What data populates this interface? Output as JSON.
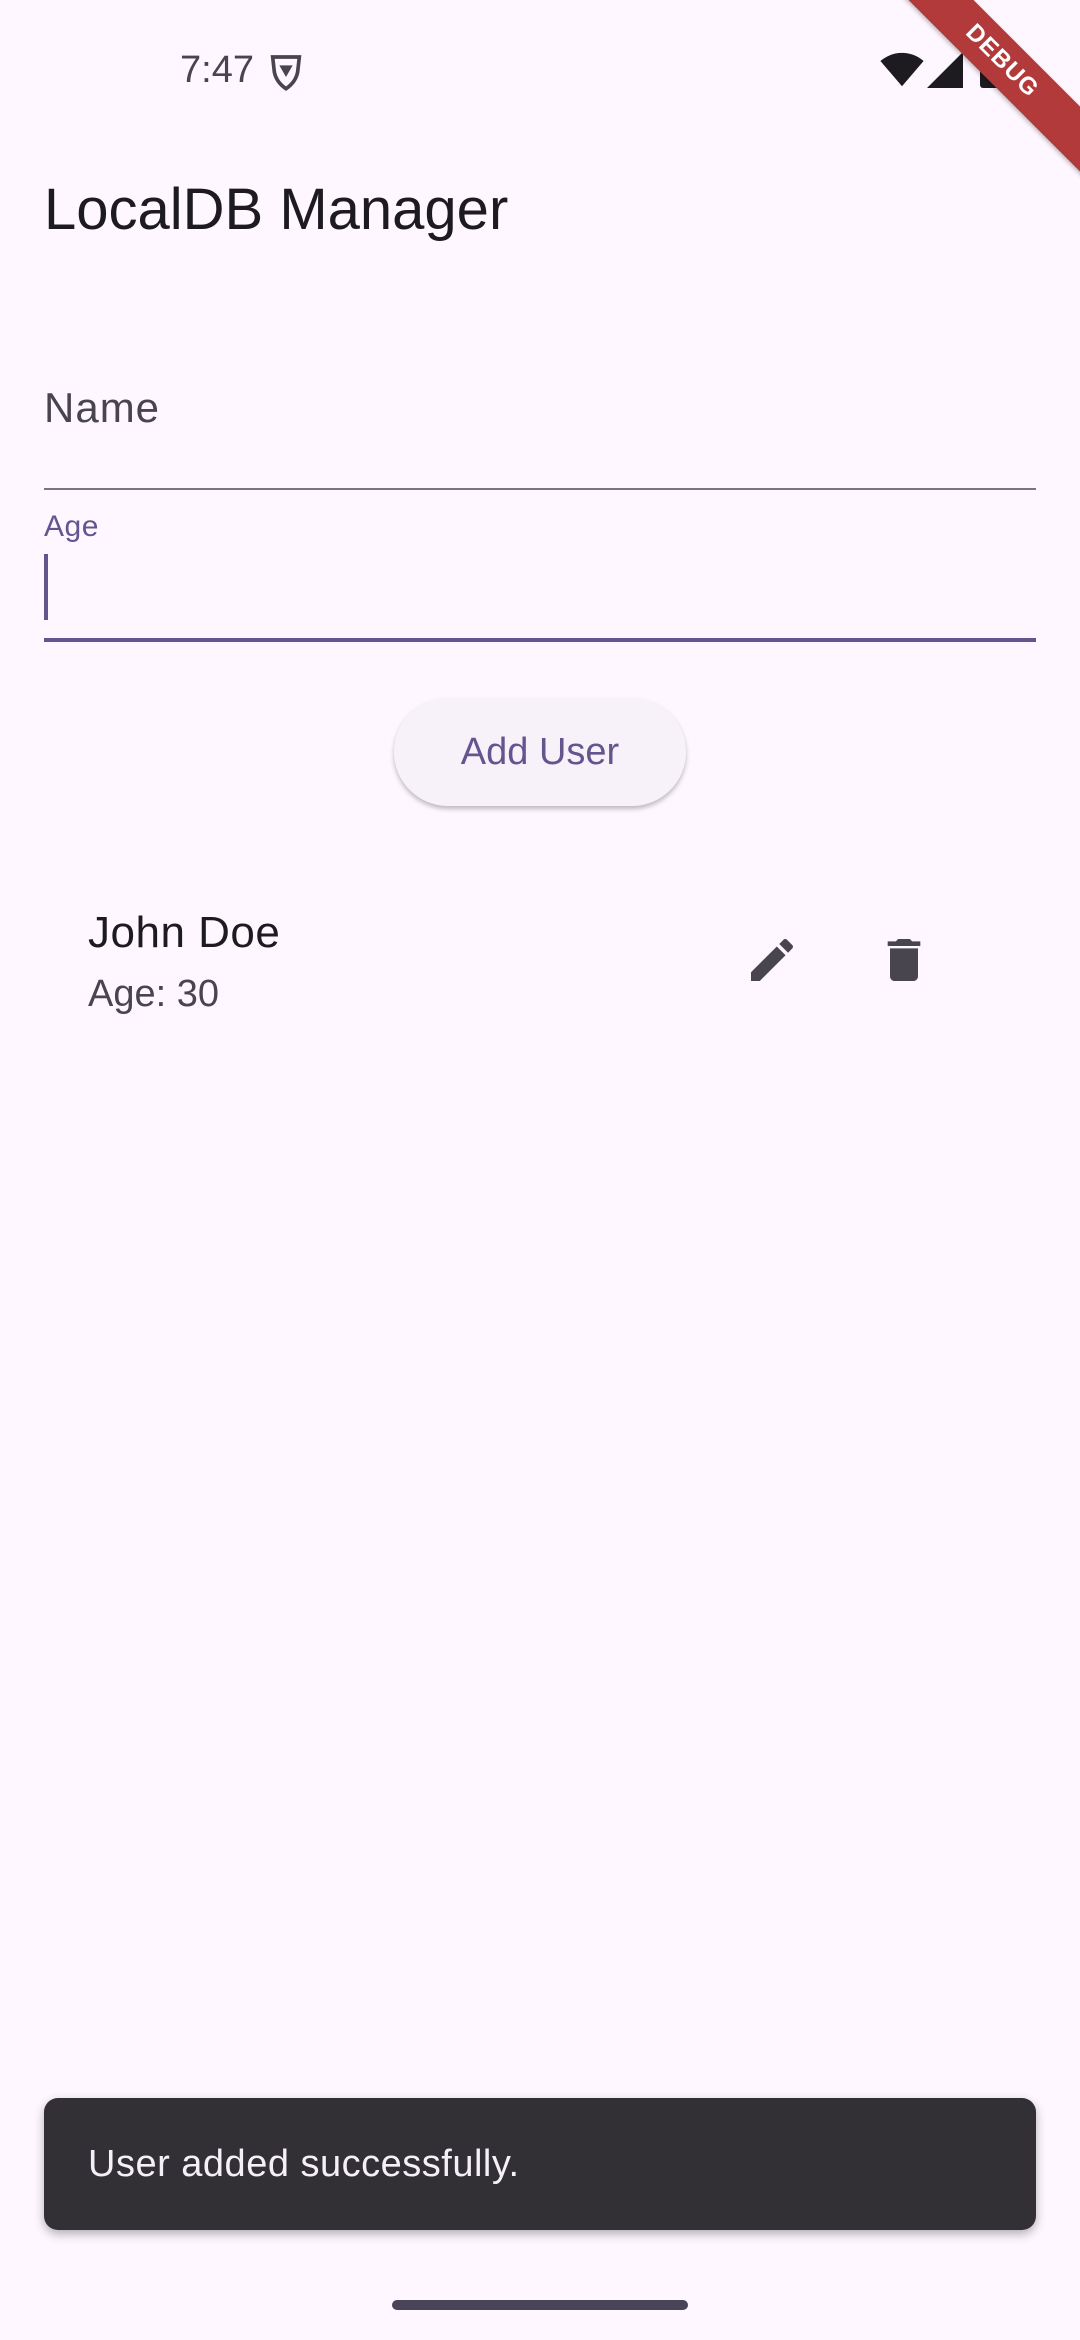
{
  "status_bar": {
    "time": "7:47",
    "icons": [
      "vpn-shield-icon",
      "wifi-icon",
      "signal-icon",
      "battery-icon"
    ]
  },
  "debug_banner": "DEBUG",
  "app": {
    "title": "LocalDB Manager"
  },
  "form": {
    "name_label": "Name",
    "name_value": "",
    "age_label": "Age",
    "age_value": "",
    "add_button_label": "Add User"
  },
  "users": [
    {
      "name": "John Doe",
      "age_text": "Age: 30",
      "actions": [
        "edit-icon",
        "delete-icon"
      ]
    }
  ],
  "snackbar": {
    "message": "User added successfully."
  },
  "colors": {
    "background": "#FEF7FF",
    "primary": "#65558F",
    "on_surface": "#1D1B20",
    "on_surface_variant": "#49454F",
    "snackbar_bg": "#322F35",
    "debug_ribbon": "#B33A3A"
  }
}
